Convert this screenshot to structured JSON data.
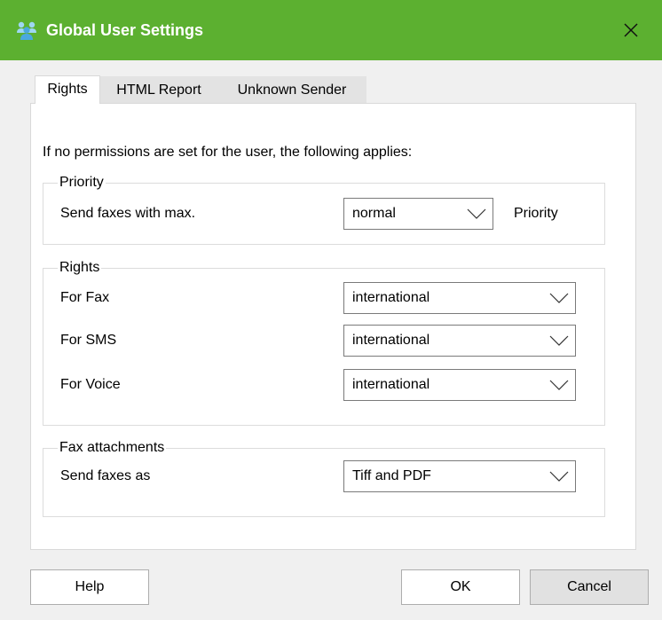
{
  "window": {
    "title": "Global User Settings",
    "titlebar_color": "#5cb030"
  },
  "tabs": [
    {
      "label": "Rights",
      "active": true
    },
    {
      "label": "HTML Report",
      "active": false
    },
    {
      "label": "Unknown Sender",
      "active": false
    }
  ],
  "info_text": "If no permissions are set for the user, the following applies:",
  "priority_group": {
    "title": "Priority",
    "label": "Send faxes with max.",
    "value": "normal",
    "suffix": "Priority"
  },
  "rights_group": {
    "title": "Rights",
    "rows": [
      {
        "label": "For Fax",
        "value": "international"
      },
      {
        "label": "For SMS",
        "value": "international"
      },
      {
        "label": "For Voice",
        "value": "international"
      }
    ]
  },
  "attachments_group": {
    "title": "Fax attachments",
    "label": "Send faxes as",
    "value": "Tiff and PDF"
  },
  "buttons": {
    "help": "Help",
    "ok": "OK",
    "cancel": "Cancel"
  }
}
